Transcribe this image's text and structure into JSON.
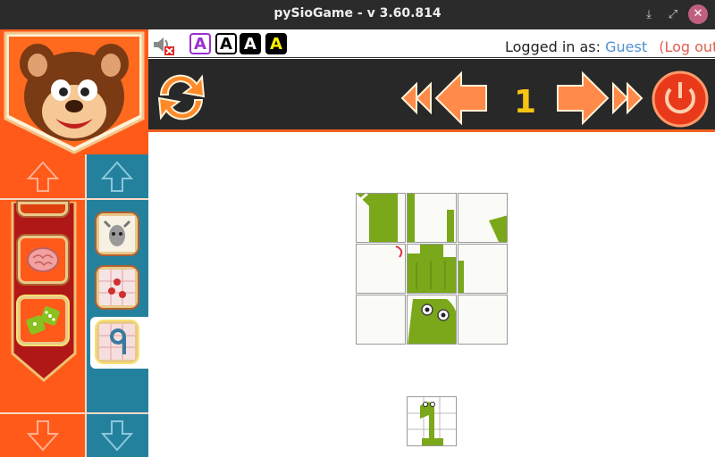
{
  "window": {
    "title": "pySioGame - v 3.60.814"
  },
  "header": {
    "logged_in_label": "Logged in as:",
    "user": "Guest",
    "logout": "(Log out)",
    "font_buttons": [
      "A",
      "A",
      "A",
      "A"
    ]
  },
  "toolbar": {
    "level": "1"
  },
  "colors": {
    "left_panel": "#ff5a1a",
    "right_panel": "#24819e",
    "toolbar": "#282828",
    "accent": "#f06020",
    "level": "#f6c412"
  }
}
